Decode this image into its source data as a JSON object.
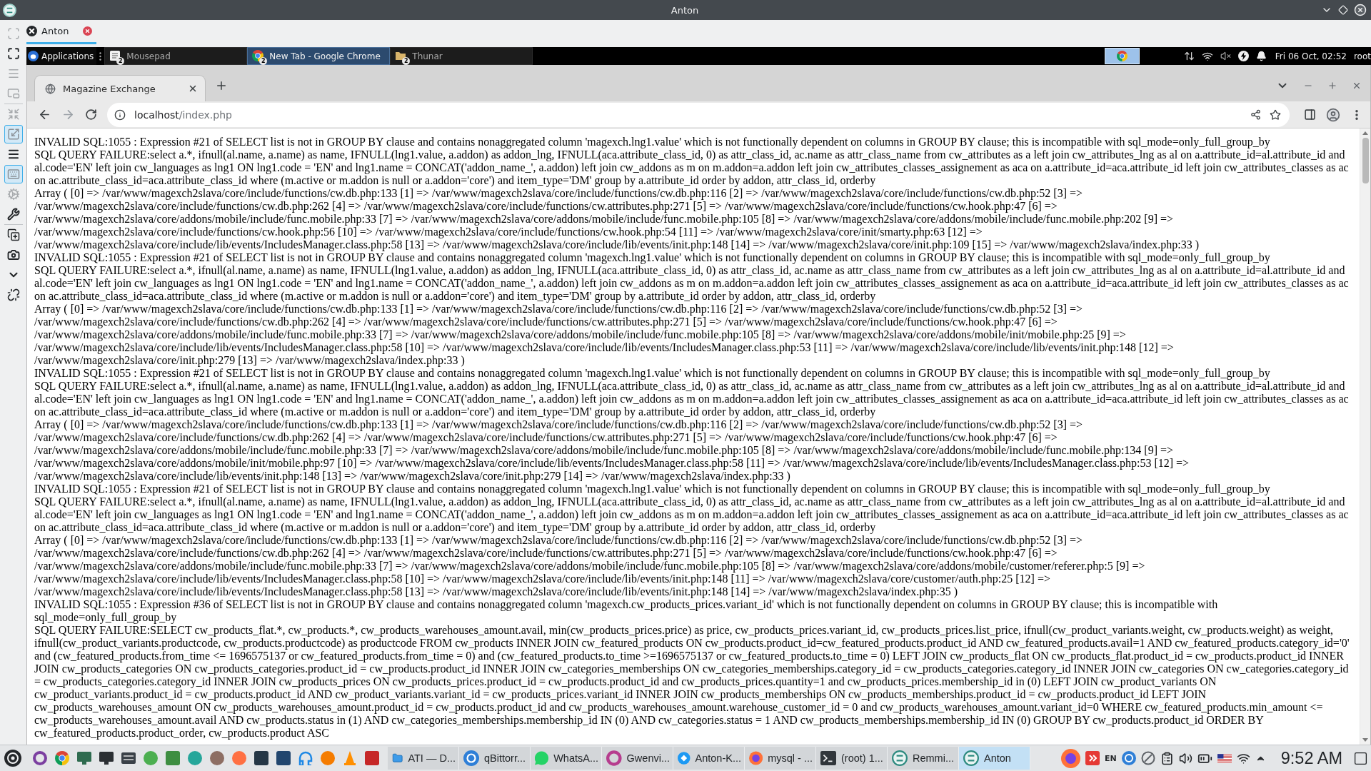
{
  "remmina": {
    "title": "Anton",
    "toolbar_groups": [
      {
        "items": [
          {
            "kind": "focus",
            "on": false,
            "disabled": true
          },
          {
            "kind": "fullscreen",
            "on": false,
            "disabled": false
          },
          {
            "kind": "menu",
            "on": false,
            "disabled": true
          },
          {
            "kind": "window",
            "on": false,
            "disabled": true
          }
        ]
      },
      {
        "items": [
          {
            "kind": "fit",
            "on": false,
            "disabled": true
          },
          {
            "kind": "scale",
            "on": true,
            "disabled": false
          },
          {
            "kind": "toolbar",
            "on": false,
            "disabled": false
          },
          {
            "kind": "keyboard",
            "on": true,
            "disabled": false
          },
          {
            "kind": "preferences",
            "on": false,
            "disabled": true
          },
          {
            "kind": "tools",
            "on": false,
            "disabled": false
          }
        ]
      },
      {
        "items": [
          {
            "kind": "duplicate",
            "on": false,
            "disabled": false
          },
          {
            "kind": "screenshot",
            "on": false,
            "disabled": false
          },
          {
            "kind": "minimize",
            "on": false,
            "disabled": false
          },
          {
            "kind": "disconnect",
            "on": false,
            "disabled": false
          }
        ]
      }
    ],
    "tabs": [
      {
        "label": "Anton",
        "selected": true
      }
    ]
  },
  "remote_panel": {
    "menu": "Applications",
    "tasks": [
      {
        "kind": "editor",
        "label": "Mousepad",
        "count": "2",
        "selected": false
      },
      {
        "kind": "browser",
        "label": "New Tab - Google Chrome",
        "count": "2",
        "selected": true
      },
      {
        "kind": "files",
        "label": "Thunar",
        "count": "2",
        "selected": false
      }
    ],
    "clock": "Fri 06 Oct, 02:52",
    "user": "root"
  },
  "browser": {
    "tabs": [
      {
        "title": "Magazine Exchange",
        "selected": true
      }
    ],
    "address": {
      "host": "localhost",
      "path": "/index.php"
    },
    "log": [
      {
        "error": "INVALID SQL:1055 : Expression #21 of SELECT list is not in GROUP BY clause and contains nonaggregated column 'magexch.lng1.value' which is not functionally dependent on columns in GROUP BY clause; this is incompatible with sql_mode=only_full_group_by",
        "query": "SQL QUERY FAILURE:select a.*, ifnull(al.name, a.name) as name, IFNULL(lng1.value, a.addon) as addon_lng, IFNULL(aca.attribute_class_id, 0) as attr_class_id, ac.name as attr_class_name from cw_attributes as a left join cw_attributes_lng as al on a.attribute_id=al.attribute_id and al.code='EN' left join cw_languages as lng1 ON lng1.code = 'EN' and lng1.name = CONCAT('addon_name_', a.addon) left join cw_addons as m on m.addon=a.addon left join cw_attributes_classes_assignement as aca on a.attribute_id=aca.attribute_id left join cw_attributes_classes as ac on ac.attribute_class_id=aca.attribute_class_id where (m.active or m.addon is null or a.addon='core') and item_type='DM' group by a.attribute_id order by addon, attr_class_id, orderby",
        "trace": "Array ( [0] => /var/www/magexch2slava/core/include/functions/cw.db.php:133 [1] => /var/www/magexch2slava/core/include/functions/cw.db.php:116 [2] => /var/www/magexch2slava/core/include/functions/cw.db.php:52 [3] => /var/www/magexch2slava/core/include/functions/cw.db.php:262 [4] => /var/www/magexch2slava/core/include/functions/cw.attributes.php:271 [5] => /var/www/magexch2slava/core/include/functions/cw.hook.php:47 [6] => /var/www/magexch2slava/core/addons/mobile/include/func.mobile.php:33 [7] => /var/www/magexch2slava/core/addons/mobile/include/func.mobile.php:105 [8] => /var/www/magexch2slava/core/addons/mobile/include/func.mobile.php:202 [9] => /var/www/magexch2slava/core/include/functions/cw.hook.php:56 [10] => /var/www/magexch2slava/core/include/functions/cw.hook.php:54 [11] => /var/www/magexch2slava/core/init/smarty.php:63 [12] => /var/www/magexch2slava/core/include/lib/events/IncludesManager.class.php:58 [13] => /var/www/magexch2slava/core/include/lib/events/init.php:148 [14] => /var/www/magexch2slava/core/init.php:109 [15] => /var/www/magexch2slava/index.php:33 )"
      },
      {
        "error": "INVALID SQL:1055 : Expression #21 of SELECT list is not in GROUP BY clause and contains nonaggregated column 'magexch.lng1.value' which is not functionally dependent on columns in GROUP BY clause; this is incompatible with sql_mode=only_full_group_by",
        "query": "SQL QUERY FAILURE:select a.*, ifnull(al.name, a.name) as name, IFNULL(lng1.value, a.addon) as addon_lng, IFNULL(aca.attribute_class_id, 0) as attr_class_id, ac.name as attr_class_name from cw_attributes as a left join cw_attributes_lng as al on a.attribute_id=al.attribute_id and al.code='EN' left join cw_languages as lng1 ON lng1.code = 'EN' and lng1.name = CONCAT('addon_name_', a.addon) left join cw_addons as m on m.addon=a.addon left join cw_attributes_classes_assignement as aca on a.attribute_id=aca.attribute_id left join cw_attributes_classes as ac on ac.attribute_class_id=aca.attribute_class_id where (m.active or m.addon is null or a.addon='core') and item_type='DM' group by a.attribute_id order by addon, attr_class_id, orderby",
        "trace": "Array ( [0] => /var/www/magexch2slava/core/include/functions/cw.db.php:133 [1] => /var/www/magexch2slava/core/include/functions/cw.db.php:116 [2] => /var/www/magexch2slava/core/include/functions/cw.db.php:52 [3] => /var/www/magexch2slava/core/include/functions/cw.db.php:262 [4] => /var/www/magexch2slava/core/include/functions/cw.attributes.php:271 [5] => /var/www/magexch2slava/core/include/functions/cw.hook.php:47 [6] => /var/www/magexch2slava/core/addons/mobile/include/func.mobile.php:33 [7] => /var/www/magexch2slava/core/addons/mobile/include/func.mobile.php:105 [8] => /var/www/magexch2slava/core/addons/mobile/init/mobile.php:25 [9] => /var/www/magexch2slava/core/include/lib/events/IncludesManager.class.php:58 [10] => /var/www/magexch2slava/core/include/lib/events/IncludesManager.class.php:53 [11] => /var/www/magexch2slava/core/include/lib/events/init.php:148 [12] => /var/www/magexch2slava/core/init.php:279 [13] => /var/www/magexch2slava/index.php:33 )"
      },
      {
        "error": "INVALID SQL:1055 : Expression #21 of SELECT list is not in GROUP BY clause and contains nonaggregated column 'magexch.lng1.value' which is not functionally dependent on columns in GROUP BY clause; this is incompatible with sql_mode=only_full_group_by",
        "query": "SQL QUERY FAILURE:select a.*, ifnull(al.name, a.name) as name, IFNULL(lng1.value, a.addon) as addon_lng, IFNULL(aca.attribute_class_id, 0) as attr_class_id, ac.name as attr_class_name from cw_attributes as a left join cw_attributes_lng as al on a.attribute_id=al.attribute_id and al.code='EN' left join cw_languages as lng1 ON lng1.code = 'EN' and lng1.name = CONCAT('addon_name_', a.addon) left join cw_addons as m on m.addon=a.addon left join cw_attributes_classes_assignement as aca on a.attribute_id=aca.attribute_id left join cw_attributes_classes as ac on ac.attribute_class_id=aca.attribute_class_id where (m.active or m.addon is null or a.addon='core') and item_type='DM' group by a.attribute_id order by addon, attr_class_id, orderby",
        "trace": "Array ( [0] => /var/www/magexch2slava/core/include/functions/cw.db.php:133 [1] => /var/www/magexch2slava/core/include/functions/cw.db.php:116 [2] => /var/www/magexch2slava/core/include/functions/cw.db.php:52 [3] => /var/www/magexch2slava/core/include/functions/cw.db.php:262 [4] => /var/www/magexch2slava/core/include/functions/cw.attributes.php:271 [5] => /var/www/magexch2slava/core/include/functions/cw.hook.php:47 [6] => /var/www/magexch2slava/core/addons/mobile/include/func.mobile.php:33 [7] => /var/www/magexch2slava/core/addons/mobile/include/func.mobile.php:105 [8] => /var/www/magexch2slava/core/addons/mobile/include/func.mobile.php:134 [9] => /var/www/magexch2slava/core/addons/mobile/init/mobile.php:97 [10] => /var/www/magexch2slava/core/include/lib/events/IncludesManager.class.php:58 [11] => /var/www/magexch2slava/core/include/lib/events/IncludesManager.class.php:53 [12] => /var/www/magexch2slava/core/include/lib/events/init.php:148 [13] => /var/www/magexch2slava/core/init.php:279 [14] => /var/www/magexch2slava/index.php:33 )"
      },
      {
        "error": "INVALID SQL:1055 : Expression #21 of SELECT list is not in GROUP BY clause and contains nonaggregated column 'magexch.lng1.value' which is not functionally dependent on columns in GROUP BY clause; this is incompatible with sql_mode=only_full_group_by",
        "query": "SQL QUERY FAILURE:select a.*, ifnull(al.name, a.name) as name, IFNULL(lng1.value, a.addon) as addon_lng, IFNULL(aca.attribute_class_id, 0) as attr_class_id, ac.name as attr_class_name from cw_attributes as a left join cw_attributes_lng as al on a.attribute_id=al.attribute_id and al.code='EN' left join cw_languages as lng1 ON lng1.code = 'EN' and lng1.name = CONCAT('addon_name_', a.addon) left join cw_addons as m on m.addon=a.addon left join cw_attributes_classes_assignement as aca on a.attribute_id=aca.attribute_id left join cw_attributes_classes as ac on ac.attribute_class_id=aca.attribute_class_id where (m.active or m.addon is null or a.addon='core') and item_type='DM' group by a.attribute_id order by addon, attr_class_id, orderby",
        "trace": "Array ( [0] => /var/www/magexch2slava/core/include/functions/cw.db.php:133 [1] => /var/www/magexch2slava/core/include/functions/cw.db.php:116 [2] => /var/www/magexch2slava/core/include/functions/cw.db.php:52 [3] => /var/www/magexch2slava/core/include/functions/cw.db.php:262 [4] => /var/www/magexch2slava/core/include/functions/cw.attributes.php:271 [5] => /var/www/magexch2slava/core/include/functions/cw.hook.php:47 [6] => /var/www/magexch2slava/core/addons/mobile/include/func.mobile.php:33 [7] => /var/www/magexch2slava/core/addons/mobile/include/func.mobile.php:105 [8] => /var/www/magexch2slava/core/addons/mobile/customer/referer.php:5 [9] => /var/www/magexch2slava/core/include/lib/events/IncludesManager.class.php:58 [10] => /var/www/magexch2slava/core/include/lib/events/init.php:148 [11] => /var/www/magexch2slava/core/customer/auth.php:25 [12] => /var/www/magexch2slava/core/include/lib/events/IncludesManager.class.php:58 [13] => /var/www/magexch2slava/core/include/lib/events/init.php:148 [14] => /var/www/magexch2slava/index.php:35 )"
      },
      {
        "error": "INVALID SQL:1055 : Expression #36 of SELECT list is not in GROUP BY clause and contains nonaggregated column 'magexch.cw_products_prices.variant_id' which is not functionally dependent on columns in GROUP BY clause; this is incompatible with sql_mode=only_full_group_by",
        "query": "SQL QUERY FAILURE:SELECT cw_products_flat.*, cw_products.*, cw_products_warehouses_amount.avail, min(cw_products_prices.price) as price, cw_products_prices.variant_id, cw_products_prices.list_price, ifnull(cw_product_variants.weight, cw_products.weight) as weight, ifnull(cw_product_variants.productcode, cw_products.productcode) as productcode FROM cw_products INNER JOIN cw_featured_products ON cw_products.product_id=cw_featured_products.product_id AND cw_featured_products.avail=1 AND cw_featured_products.category_id='0' and (cw_featured_products.from_time <= 1696575137 or cw_featured_products.from_time = 0) and (cw_featured_products.to_time >=1696575137 or cw_featured_products.to_time = 0) LEFT JOIN cw_products_flat ON cw_products_flat.product_id = cw_products.product_id INNER JOIN cw_products_categories ON cw_products_categories.product_id = cw_products.product_id INNER JOIN cw_categories_memberships ON cw_categories_memberships.category_id = cw_products_categories.category_id INNER JOIN cw_categories ON cw_categories.category_id = cw_products_categories.category_id INNER JOIN cw_products_prices ON cw_products_prices.product_id = cw_products.product_id and cw_products_prices.quantity=1 and cw_products_prices.membership_id in (0) LEFT JOIN cw_product_variants ON cw_product_variants.product_id = cw_products.product_id AND cw_product_variants.variant_id = cw_products_prices.variant_id INNER JOIN cw_products_memberships ON cw_products_memberships.product_id = cw_products.product_id LEFT JOIN cw_products_warehouses_amount ON cw_products_warehouses_amount.product_id = cw_products.product_id and cw_products_warehouses_amount.warehouse_customer_id = 0 and cw_products_warehouses_amount.variant_id=0 WHERE cw_featured_products.min_amount <= cw_products_warehouses_amount.avail AND cw_products.status in (1) AND cw_categories_memberships.membership_id IN (0) AND cw_categories.status = 1 AND cw_products_memberships.membership_id IN (0) GROUP BY cw_products.product_id ORDER BY cw_featured_products.product_order, cw_products.product ASC"
      }
    ]
  },
  "taskbar": {
    "tasks": [
      {
        "kind": "folder",
        "label": "ATI — D...",
        "selected": false
      },
      {
        "kind": "torrent",
        "label": "qBittorr...",
        "selected": false
      },
      {
        "kind": "chat",
        "label": "WhatsA...",
        "selected": false
      },
      {
        "kind": "viewer",
        "label": "Gwenvi...",
        "selected": false
      },
      {
        "kind": "remote",
        "label": "Anton-K...",
        "selected": false
      },
      {
        "kind": "browser",
        "label": "mysql - ...",
        "selected": false
      },
      {
        "kind": "terminal",
        "label": "(root) 1...",
        "selected": false
      },
      {
        "kind": "remmina",
        "label": "Remmi...",
        "selected": false
      },
      {
        "kind": "remmina",
        "label": "Anton",
        "selected": true
      }
    ],
    "keyboard_layout": "EN",
    "clock": "9:52 AM"
  }
}
